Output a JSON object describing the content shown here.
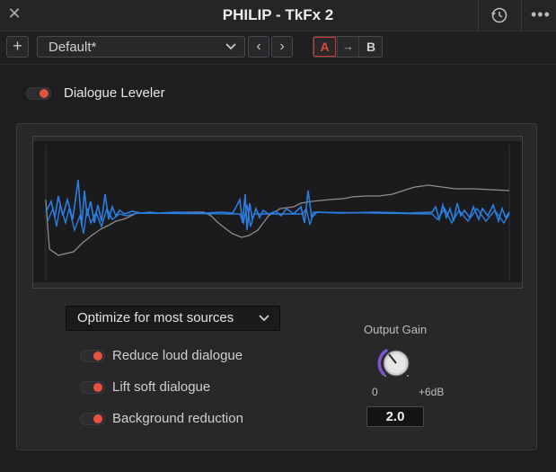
{
  "titlebar": {
    "title": "PHILIP - TkFx 2",
    "close_icon": "close-icon",
    "history_icon": "history-icon",
    "more_icon": "more-icon"
  },
  "toolbar": {
    "add_label": "+",
    "preset_value": "Default*",
    "prev_label": "‹",
    "next_label": "›",
    "ab_a": "A",
    "ab_copy": "→",
    "ab_b": "B"
  },
  "dialogue_leveler": {
    "label": "Dialogue Leveler",
    "enabled": true
  },
  "mode": {
    "selected": "Optimize for most sources"
  },
  "options": [
    {
      "label": "Reduce loud dialogue",
      "enabled": true
    },
    {
      "label": "Lift soft dialogue",
      "enabled": true
    },
    {
      "label": "Background reduction",
      "enabled": true
    }
  ],
  "output_gain": {
    "label": "Output Gain",
    "min_label": "0",
    "max_label": "+6dB",
    "value": "2.0"
  },
  "colors": {
    "accent_red": "#e8523c",
    "waveform_blue": "#2a7ee0",
    "curve_gray": "#8d8d8d",
    "knob_purple": "#7a56c8"
  }
}
